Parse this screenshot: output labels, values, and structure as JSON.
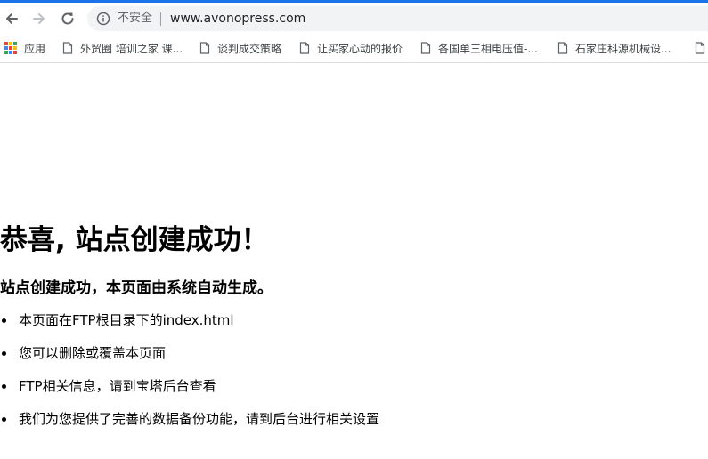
{
  "browser": {
    "security_label": "不安全",
    "url": "www.avonopress.com",
    "accent_color": "#1a73e8"
  },
  "bookmarks": [
    {
      "label": "应用",
      "icon": "apps-grid-icon"
    },
    {
      "label": "外贸圈 培训之家 课...",
      "icon": "page-icon"
    },
    {
      "label": "谈判成交策略",
      "icon": "page-icon"
    },
    {
      "label": "让买家心动的报价",
      "icon": "page-icon"
    },
    {
      "label": "各国单三相电压值-...",
      "icon": "page-icon"
    },
    {
      "label": "石家庄科源机械设...",
      "icon": "page-icon"
    },
    {
      "label": "",
      "icon": "page-icon"
    }
  ],
  "page": {
    "heading": "恭喜, 站点创建成功！",
    "subheading": "站点创建成功，本页面由系统自动生成。",
    "items": [
      "本页面在FTP根目录下的index.html",
      "您可以删除或覆盖本页面",
      "FTP相关信息，请到宝塔后台查看",
      "我们为您提供了完善的数据备份功能，请到后台进行相关设置"
    ]
  }
}
